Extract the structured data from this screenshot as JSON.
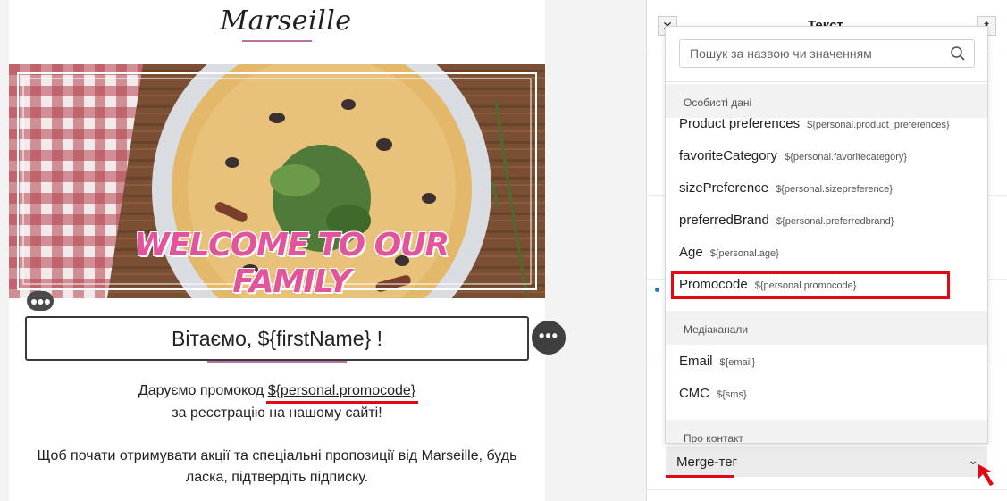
{
  "email": {
    "logo": "Marseille",
    "banner_title": "WELCOME TO OUR FAMILY",
    "greeting": "Вітаємо, ${firstName} !",
    "promo_prefix": "Даруємо промокод ",
    "promo_variable": "${personal.promocode}",
    "registration_line": "за реєстрацію на нашому сайті!",
    "confirm_text": "Щоб почати отримувати акції та спеціальні пропозиції від Marseille, будь ласка, підтвердіть підписку.",
    "drag_handle_icon": "grip-dots-icon",
    "more_icon": "ellipsis-icon"
  },
  "panel": {
    "title": "Текст",
    "close_icon": "close-icon",
    "pin_icon": "pin-icon",
    "merge_tag_label": "Merge-тег",
    "merge_chevron_icon": "chevron-down-icon"
  },
  "dropdown": {
    "search_placeholder": "Пошук за назвою чи значенням",
    "search_value": "",
    "groups": [
      {
        "title": "Особисті дані",
        "items": [
          {
            "label": "Product preferences",
            "tag": "${personal.product_preferences}"
          },
          {
            "label": "favoriteCategory",
            "tag": "${personal.favoritecategory}"
          },
          {
            "label": "sizePreference",
            "tag": "${personal.sizepreference}"
          },
          {
            "label": "preferredBrand",
            "tag": "${personal.preferredbrand}"
          },
          {
            "label": "Age",
            "tag": "${personal.age}"
          },
          {
            "label": "Promocode",
            "tag": "${personal.promocode}"
          }
        ]
      },
      {
        "title": "Медіаканали",
        "items": [
          {
            "label": "Email",
            "tag": "${email}"
          },
          {
            "label": "СМС",
            "tag": "${sms}"
          }
        ]
      },
      {
        "title": "Про контакт",
        "items": []
      }
    ]
  },
  "colors": {
    "accent_pink": "#b9739f",
    "annotation_red": "#e30613",
    "banner_pink": "#e3559a"
  }
}
